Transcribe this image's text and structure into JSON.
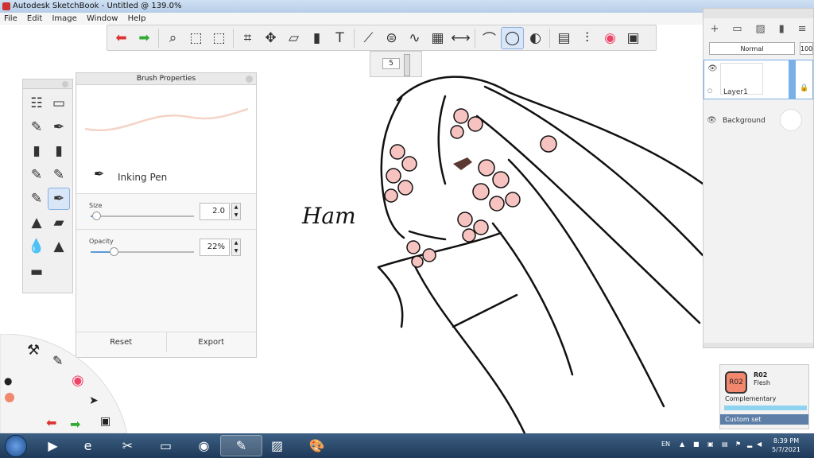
{
  "window": {
    "title": "Autodesk SketchBook - Untitled @ 139.0%"
  },
  "menu": [
    "File",
    "Edit",
    "Image",
    "Window",
    "Help"
  ],
  "toolbar": {
    "icons": [
      "undo-icon",
      "redo-icon",
      "zoom-icon",
      "select-icon",
      "lasso-icon",
      "crop-icon",
      "transform-icon",
      "distort-icon",
      "fill-icon",
      "text-icon",
      "ruler-icon",
      "ellipse-guide-icon",
      "curve-icon",
      "perspective-icon",
      "symmetry-icon",
      "stroke-icon",
      "predictive-stroke-icon",
      "shape-icon",
      "copic-icon",
      "brush-set-icon",
      "color-wheel-icon",
      "library-icon"
    ],
    "active": "predictive-stroke-icon"
  },
  "brush_size_puck": {
    "value": "5"
  },
  "brush_properties": {
    "title": "Brush Properties",
    "brush_name": "Inking Pen",
    "size_label": "Size",
    "size_value": "2.0",
    "size_fraction": 0.05,
    "opacity_label": "Opacity",
    "opacity_value": "22%",
    "opacity_fraction": 0.22,
    "reset_label": "Reset",
    "export_label": "Export"
  },
  "layers": {
    "blend_mode": "Normal",
    "opacity": "100",
    "items": [
      {
        "name": "Layer1",
        "selected": true
      },
      {
        "name": "Background",
        "selected": false
      }
    ]
  },
  "color": {
    "code": "R02",
    "name": "Flesh",
    "complement": "Complementary",
    "custom_set": "Custom set",
    "swatch": "#f1876d"
  },
  "canvas": {
    "signature": "Ham"
  },
  "taskbar": {
    "language": "EN",
    "time": "8:39 PM",
    "date": "5/7/2021"
  }
}
